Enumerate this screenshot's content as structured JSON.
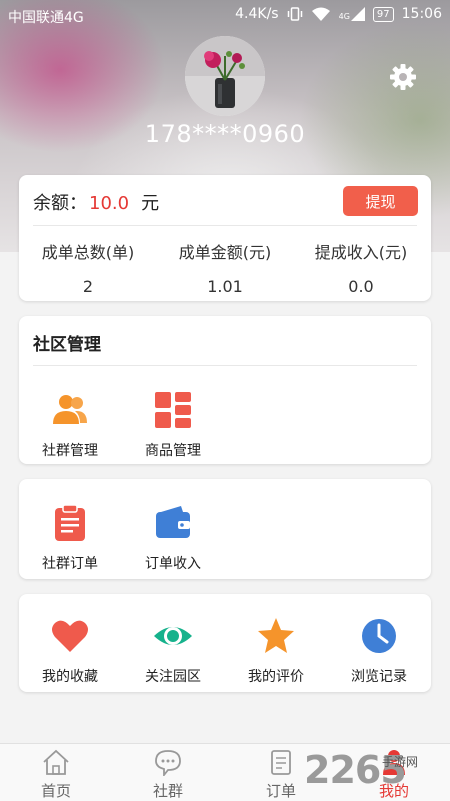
{
  "status_bar": {
    "carrier": "中国联通4G",
    "speed": "4.4K/s",
    "network": "4G",
    "battery": "97",
    "time": "15:06"
  },
  "profile": {
    "phone": "178****0960"
  },
  "balance": {
    "label": "余额：",
    "value": "10.0",
    "unit": "元",
    "withdraw_label": "提现",
    "stats": [
      {
        "label": "成单总数(单)",
        "value": "2"
      },
      {
        "label": "成单金额(元)",
        "value": "1.01"
      },
      {
        "label": "提成收入(元)",
        "value": "0.0"
      }
    ]
  },
  "community": {
    "title": "社区管理",
    "items": [
      {
        "label": "社群管理",
        "icon": "users-icon"
      },
      {
        "label": "商品管理",
        "icon": "grid-icon"
      }
    ]
  },
  "orders": {
    "items": [
      {
        "label": "社群订单",
        "icon": "clipboard-icon"
      },
      {
        "label": "订单收入",
        "icon": "wallet-icon"
      }
    ]
  },
  "favorites": {
    "items": [
      {
        "label": "我的收藏",
        "icon": "heart-icon"
      },
      {
        "label": "关注园区",
        "icon": "eye-icon"
      },
      {
        "label": "我的评价",
        "icon": "star-icon"
      },
      {
        "label": "浏览记录",
        "icon": "clock-icon"
      }
    ]
  },
  "nav": {
    "items": [
      {
        "label": "首页",
        "icon": "home-icon"
      },
      {
        "label": "社群",
        "icon": "chat-icon"
      },
      {
        "label": "订单",
        "icon": "order-icon"
      },
      {
        "label": "我的",
        "icon": "person-icon"
      }
    ],
    "active_index": 3
  },
  "watermark": {
    "text": "2265",
    "sub": "手游网"
  },
  "colors": {
    "accent": "#e53935",
    "button": "#f15f4b",
    "orange": "#f5942b",
    "green": "#16b28c",
    "blue": "#3f7fd6"
  }
}
